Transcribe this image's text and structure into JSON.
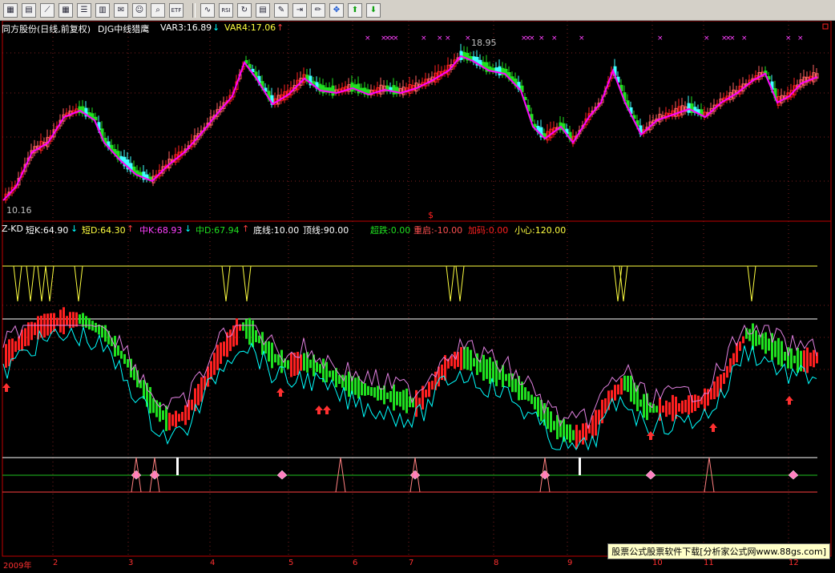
{
  "toolbar": {
    "icons": [
      "chart-grid-icon",
      "table-icon",
      "line-chart-icon",
      "grid-icon",
      "list-icon",
      "spreadsheet-icon",
      "mail-icon",
      "people-icon",
      "search-icon",
      "etf-icon",
      "wave-icon",
      "rsi-icon",
      "refresh-icon",
      "report-icon",
      "tools-icon",
      "exit-icon",
      "pen-icon",
      "move-icon",
      "arrow-up-icon",
      "arrow-down-icon"
    ],
    "rsi_label": "RSI",
    "etf_label": "ETF"
  },
  "price_panel": {
    "stock_title": "同方股份(日线,前复权)",
    "indicator": "DJG中线猎鹰",
    "var3": "VAR3:16.89",
    "var3_arrow": "↓",
    "var4": "VAR4:17.06",
    "var4_arrow": "↑",
    "high_label": "18.95",
    "low_label": "10.16",
    "marker": "$"
  },
  "kd_panel": {
    "name": "Z-KD",
    "short_k": "短K:64.90",
    "short_k_arrow": "↓",
    "short_d": "短D:64.30",
    "short_d_arrow": "↑",
    "mid_k": "中K:68.93",
    "mid_k_arrow": "↓",
    "mid_d": "中D:67.94",
    "mid_d_arrow": "↑",
    "bottom_line": "底线:10.00",
    "top_line": "顶线:90.00",
    "oversold": "超跌:0.00",
    "restart": "重启:-10.00",
    "add": "加码:0.00",
    "caution": "小心:120.00"
  },
  "colors": {
    "up": "#ff2020",
    "down": "#20e020",
    "ma_green": "#00ff00",
    "ma_magenta": "#ff00ff",
    "short_k": "#00ffff",
    "short_d": "#e080e0",
    "yellow": "#ffff40",
    "frame": "#c00000"
  },
  "axis": {
    "months": [
      "2009年",
      "2",
      "3",
      "4",
      "5",
      "6",
      "7",
      "8",
      "9",
      "10",
      "11",
      "12"
    ]
  },
  "watermark": "股票公式股票软件下载[分析家公式网www.88gs.com]"
}
